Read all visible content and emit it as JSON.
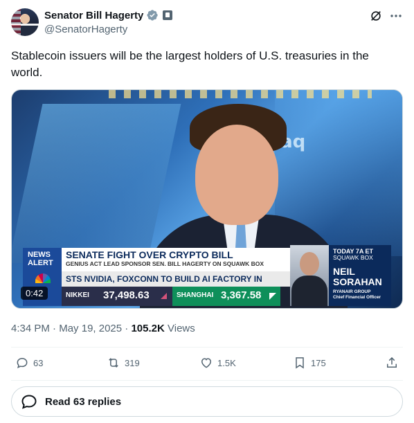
{
  "author": {
    "name": "Senator Bill Hagerty",
    "handle": "@SenatorHagerty"
  },
  "post": {
    "text": "Stablecoin issuers will be the largest holders of U.S. treasuries in the world."
  },
  "video": {
    "wall_text": "sdaq",
    "duration": "0:42",
    "lower_third": {
      "alert_line1": "NEWS",
      "alert_line2": "ALERT",
      "headline": "SENATE FIGHT OVER CRYPTO BILL",
      "subheadline": "GENIUS ACT LEAD SPONSOR SEN. BILL HAGERTY ON SQUAWK BOX",
      "ticker": "STS    NVIDIA, FOXCONN TO BUILD AI FACTORY IN",
      "market1_label": "NIKKEI",
      "market1_value": "37,498.63",
      "market2_label": "SHANGHAI",
      "market2_value": "3,367.58",
      "show_time": "TODAY 7A ET",
      "show_name": "SQUAWK BOX",
      "guest_first": "NEIL",
      "guest_last": "SORAHAN",
      "guest_org": "RYANAIR GROUP",
      "guest_title": "Chief Financial Officer"
    }
  },
  "meta": {
    "time": "4:34 PM",
    "sep1": " · ",
    "date": "May 19, 2025",
    "sep2": " · ",
    "views_count": "105.2K",
    "views_label": " Views"
  },
  "actions": {
    "replies": "63",
    "reposts": "319",
    "likes": "1.5K",
    "bookmarks": "175"
  },
  "replies_button": {
    "label": "Read 63 replies"
  },
  "colors": {
    "verified": "#829aab",
    "text_primary": "#0f1419",
    "text_secondary": "#536471"
  }
}
